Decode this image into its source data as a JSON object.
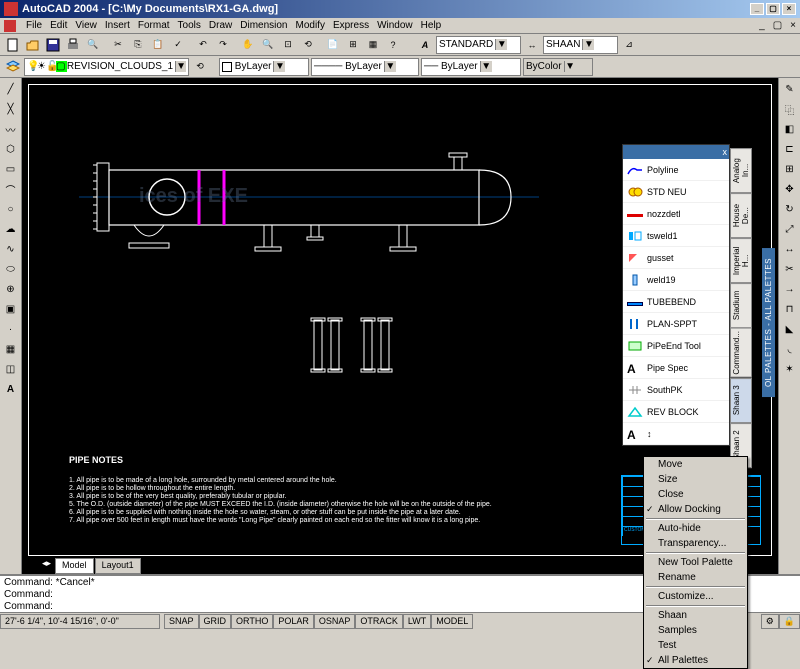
{
  "app": {
    "title": "AutoCAD 2004 - [C:\\My Documents\\RX1-GA.dwg]"
  },
  "menubar": [
    "File",
    "Edit",
    "View",
    "Insert",
    "Format",
    "Tools",
    "Draw",
    "Dimension",
    "Modify",
    "Express",
    "Window",
    "Help"
  ],
  "toolbar1": {
    "layer_name": "REVISION_CLOUDS_1",
    "textstyle": "STANDARD",
    "dimstyle": "SHAAN"
  },
  "toolbar2": {
    "color": "ByLayer",
    "linetype": "ByLayer",
    "lineweight": "ByLayer",
    "plotstyle": "ByColor"
  },
  "canvas_tabs": [
    "Model",
    "Layout1"
  ],
  "palette": {
    "title_x": "x",
    "items": [
      {
        "label": "Polyline",
        "icon": "polyline"
      },
      {
        "label": "STD NEU",
        "icon": "std"
      },
      {
        "label": "nozzdetl",
        "icon": "nozz"
      },
      {
        "label": "tsweld1",
        "icon": "tsweld"
      },
      {
        "label": "gusset",
        "icon": "gusset"
      },
      {
        "label": "weld19",
        "icon": "weld"
      },
      {
        "label": "TUBEBEND",
        "icon": "tube"
      },
      {
        "label": "PLAN-SPPT",
        "icon": "plan"
      },
      {
        "label": "PiPeEnd Tool",
        "icon": "pipeend"
      },
      {
        "label": "Pipe Spec",
        "icon": "A"
      },
      {
        "label": "SouthPK",
        "icon": "south"
      },
      {
        "label": "REV BLOCK",
        "icon": "rev"
      }
    ],
    "side_tabs": [
      "Analog In...",
      "House De...",
      "Imperial H...",
      "Stadium",
      "Command...",
      "Shaan 3",
      "Shaan 2"
    ],
    "vert_label": "OL PALETTES - ALL PALETTES"
  },
  "context_menu": {
    "items": [
      {
        "label": "Move"
      },
      {
        "label": "Size"
      },
      {
        "label": "Close"
      },
      {
        "label": "Allow Docking",
        "checked": true
      },
      {
        "sep": true
      },
      {
        "label": "Auto-hide"
      },
      {
        "label": "Transparency..."
      },
      {
        "sep": true
      },
      {
        "label": "New Tool Palette"
      },
      {
        "label": "Rename"
      },
      {
        "sep": true
      },
      {
        "label": "Customize..."
      },
      {
        "sep": true
      },
      {
        "label": "Shaan"
      },
      {
        "label": "Samples"
      },
      {
        "label": "Test"
      },
      {
        "label": "All Palettes",
        "checked": true
      }
    ]
  },
  "command": {
    "line1": "Command: *Cancel*",
    "line2": "Command:",
    "line3": "Command:"
  },
  "statusbar": {
    "coords": "27'-6 1/4\",  10'-4 15/16\", 0'-0\"",
    "buttons": [
      "SNAP",
      "GRID",
      "ORTHO",
      "POLAR",
      "OSNAP",
      "OTRACK",
      "LWT",
      "MODEL"
    ]
  },
  "drawing": {
    "notes_title": "PIPE NOTES",
    "notes": [
      "1.    All pipe is to be made of a long hole, surrounded by metal centered around the hole.",
      "2.    All pipe is to be hollow throughout the entire length.",
      "3.    All pipe is to be of the very best quality, preferably tubular or pipular.",
      "5.    The O.D. (outside diameter) of the pipe MUST EXCEED the I.D. (inside diameter) otherwise the hole will be on the    outside of the pipe.",
      "6.    All pipe is to be supplied with nothing inside the hole so water, steam, or other stuff can be put inside the pipe at a later date.",
      "7.    All pipe over 500 feet in length must have the words \"Long Pipe\" clearly painted on each end so the fitter will know it is a long pipe."
    ],
    "watermark": "ices of EXE"
  }
}
